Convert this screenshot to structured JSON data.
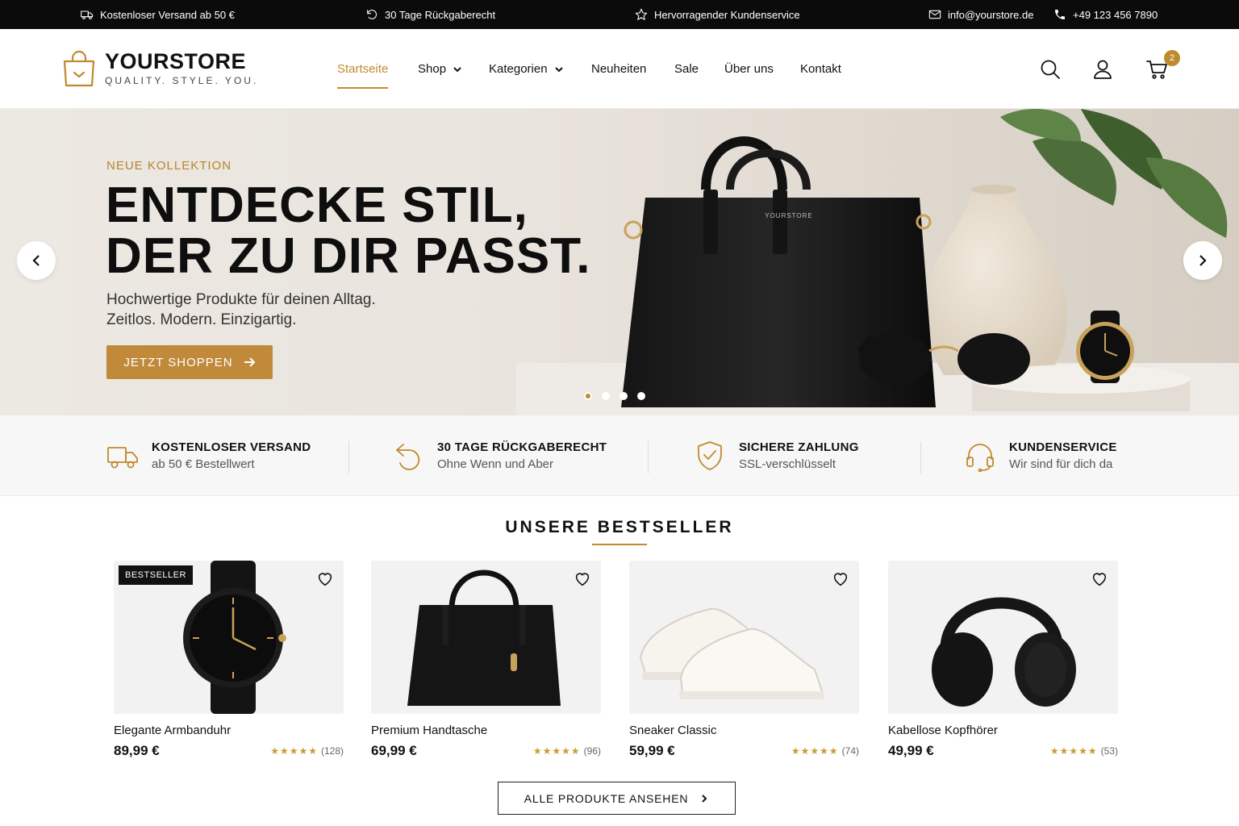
{
  "topbar": {
    "shipping": "Kostenloser Versand ab 50 €",
    "returns": "30 Tage Rückgaberecht",
    "service": "Hervorragender Kundenservice",
    "email": "info@yourstore.de",
    "phone": "+49 123 456 7890"
  },
  "brand": {
    "name": "YOURSTORE",
    "tagline": "QUALITY. STYLE. YOU.",
    "accent": "#c08a2e"
  },
  "nav": {
    "items": [
      "Startseite",
      "Shop",
      "Kategorien",
      "Neuheiten",
      "Sale",
      "Über uns",
      "Kontakt"
    ],
    "active": "Startseite"
  },
  "header": {
    "cart_count": "2"
  },
  "hero": {
    "kicker": "NEUE KOLLEKTION",
    "title_line1": "ENTDECKE STIL,",
    "title_line2": "DER ZU DIR PASST.",
    "sub_line1": "Hochwertige Produkte für deinen Alltag.",
    "sub_line2": "Zeitlos. Modern. Einzigartig.",
    "cta": "JETZT SHOPPEN",
    "bag_label": "YOURSTORE",
    "slide_count": 4,
    "active_slide": 1
  },
  "features": [
    {
      "icon": "truck-icon",
      "title": "KOSTENLOSER VERSAND",
      "sub": "ab 50 € Bestellwert"
    },
    {
      "icon": "return-icon",
      "title": "30 TAGE RÜCKGABERECHT",
      "sub": "Ohne Wenn und Aber"
    },
    {
      "icon": "shield-check-icon",
      "title": "SICHERE ZAHLUNG",
      "sub": "SSL-verschlüsselt"
    },
    {
      "icon": "headset-icon",
      "title": "KUNDENSERVICE",
      "sub": "Wir sind für dich da"
    }
  ],
  "bestseller": {
    "title": "UNSERE BESTSELLER",
    "badge": "BESTSELLER",
    "products": [
      {
        "name": "Elegante Armbanduhr",
        "price": "89,99 €",
        "stars": "★★★★★",
        "reviews": "(128)"
      },
      {
        "name": "Premium Handtasche",
        "price": "69,99 €",
        "stars": "★★★★★",
        "reviews": "(96)"
      },
      {
        "name": "Sneaker Classic",
        "price": "59,99 €",
        "stars": "★★★★★",
        "reviews": "(74)"
      },
      {
        "name": "Kabellose Kopfhörer",
        "price": "49,99 €",
        "stars": "★★★★★",
        "reviews": "(53)"
      }
    ],
    "all_button": "ALLE PRODUKTE ANSEHEN"
  }
}
